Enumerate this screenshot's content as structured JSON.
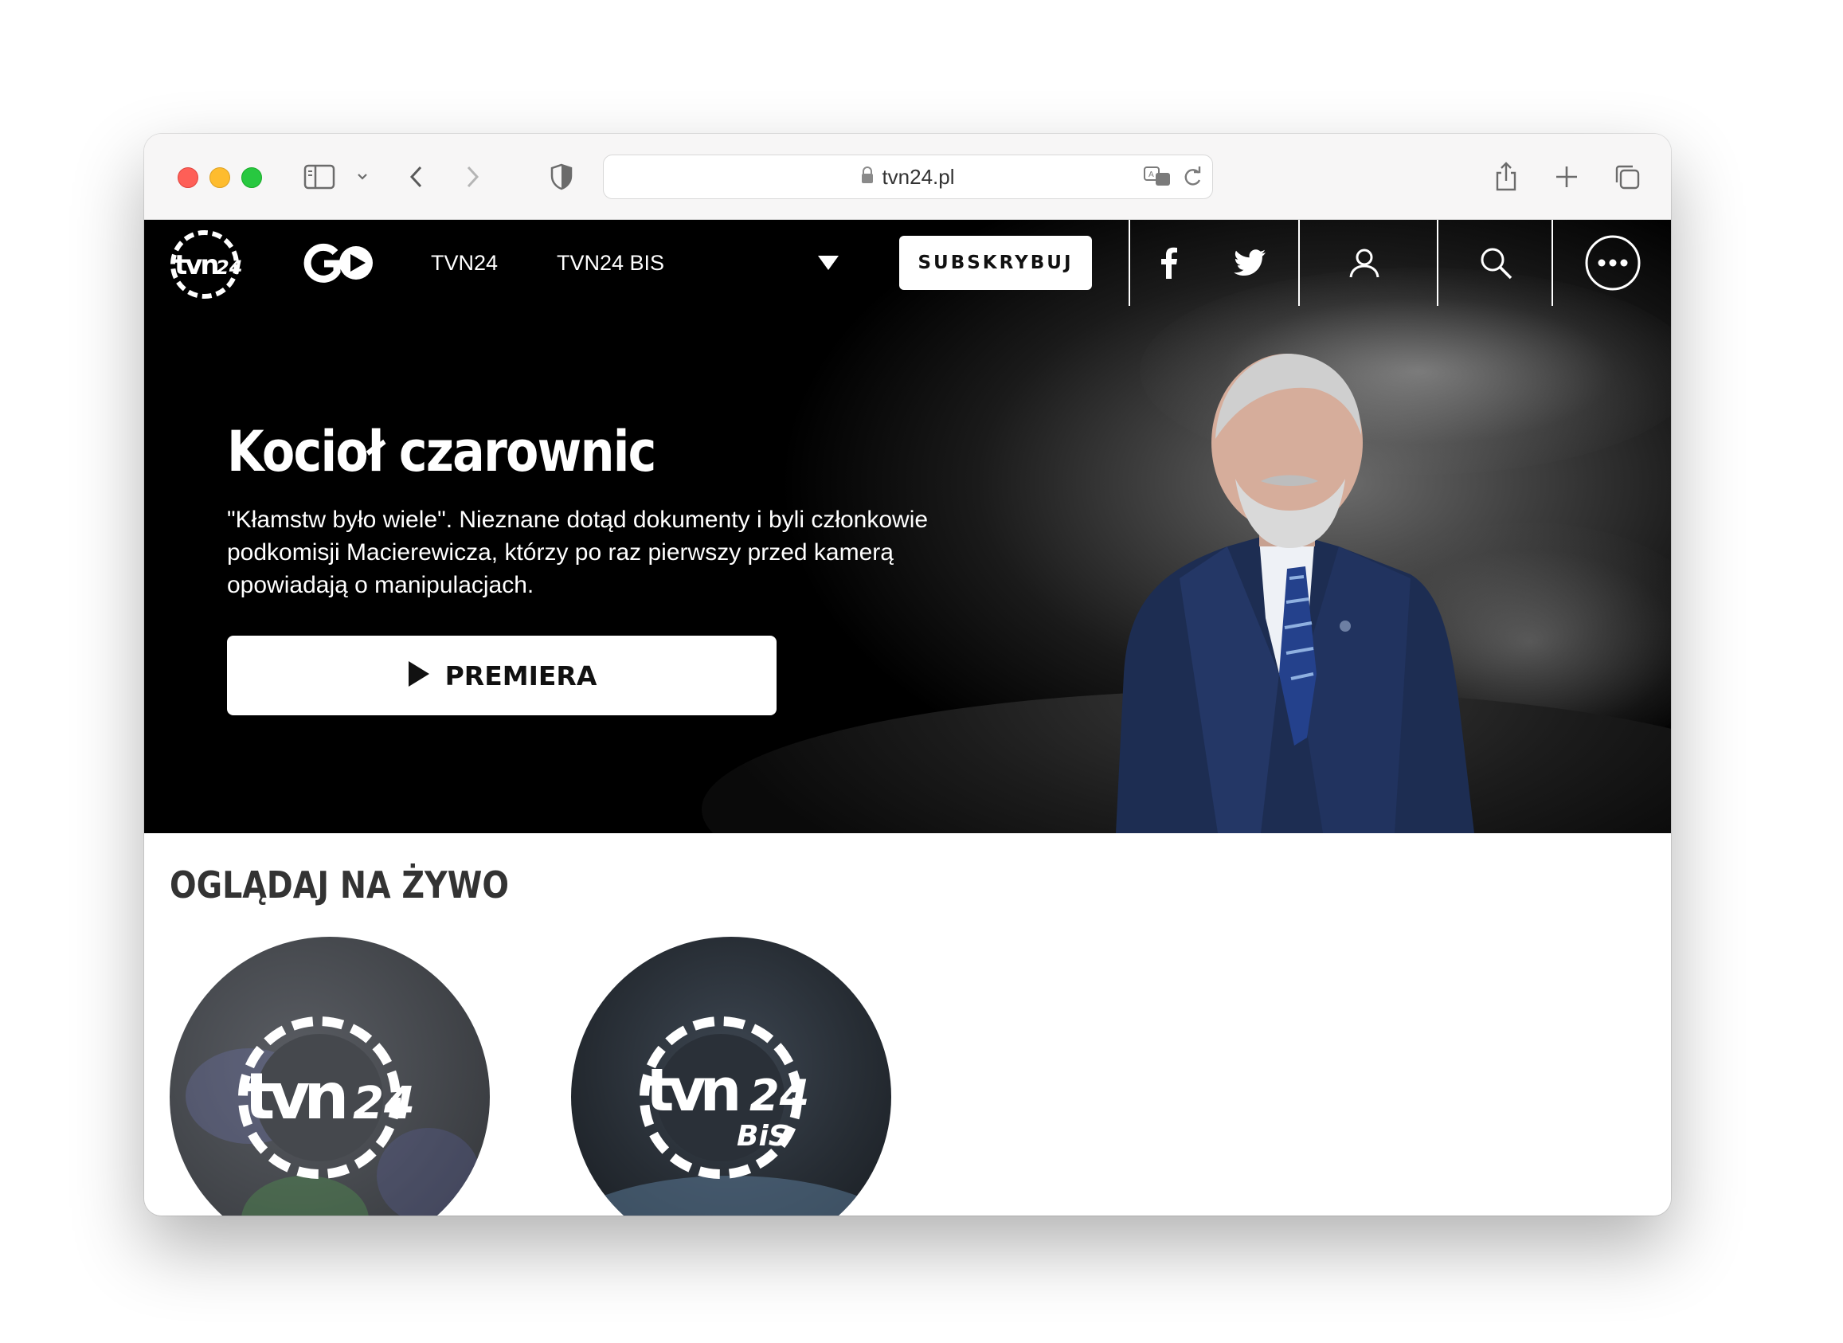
{
  "browser": {
    "url": "tvn24.pl"
  },
  "nav": {
    "logo": "tvn24",
    "go_logo": "GO",
    "links": [
      "TVN24",
      "TVN24 BIS"
    ],
    "subscribe_label": "SUBSKRYBUJ"
  },
  "hero": {
    "title": "Kocioł czarownic",
    "description": "\"Kłamstw było wiele\". Nieznane dotąd dokumenty i byli członkowie podkomisji Macierewicza, którzy po raz pierwszy przed kamerą opowiadają o manipulacjach.",
    "button_label": "PREMIERA"
  },
  "live": {
    "title": "OGLĄDAJ NA ŻYWO",
    "channels": [
      {
        "logo": "tvn24",
        "logo_main": "tvn",
        "logo_num": "24"
      },
      {
        "logo": "tvn24 BiS",
        "logo_main": "tvn",
        "logo_num": "24",
        "logo_sub": "BiS"
      }
    ]
  },
  "colors": {
    "traffic_red": "#fe5f57",
    "traffic_yellow": "#febc2e",
    "traffic_green": "#28c840",
    "hero_bg": "#000000",
    "section_title": "#333333"
  }
}
